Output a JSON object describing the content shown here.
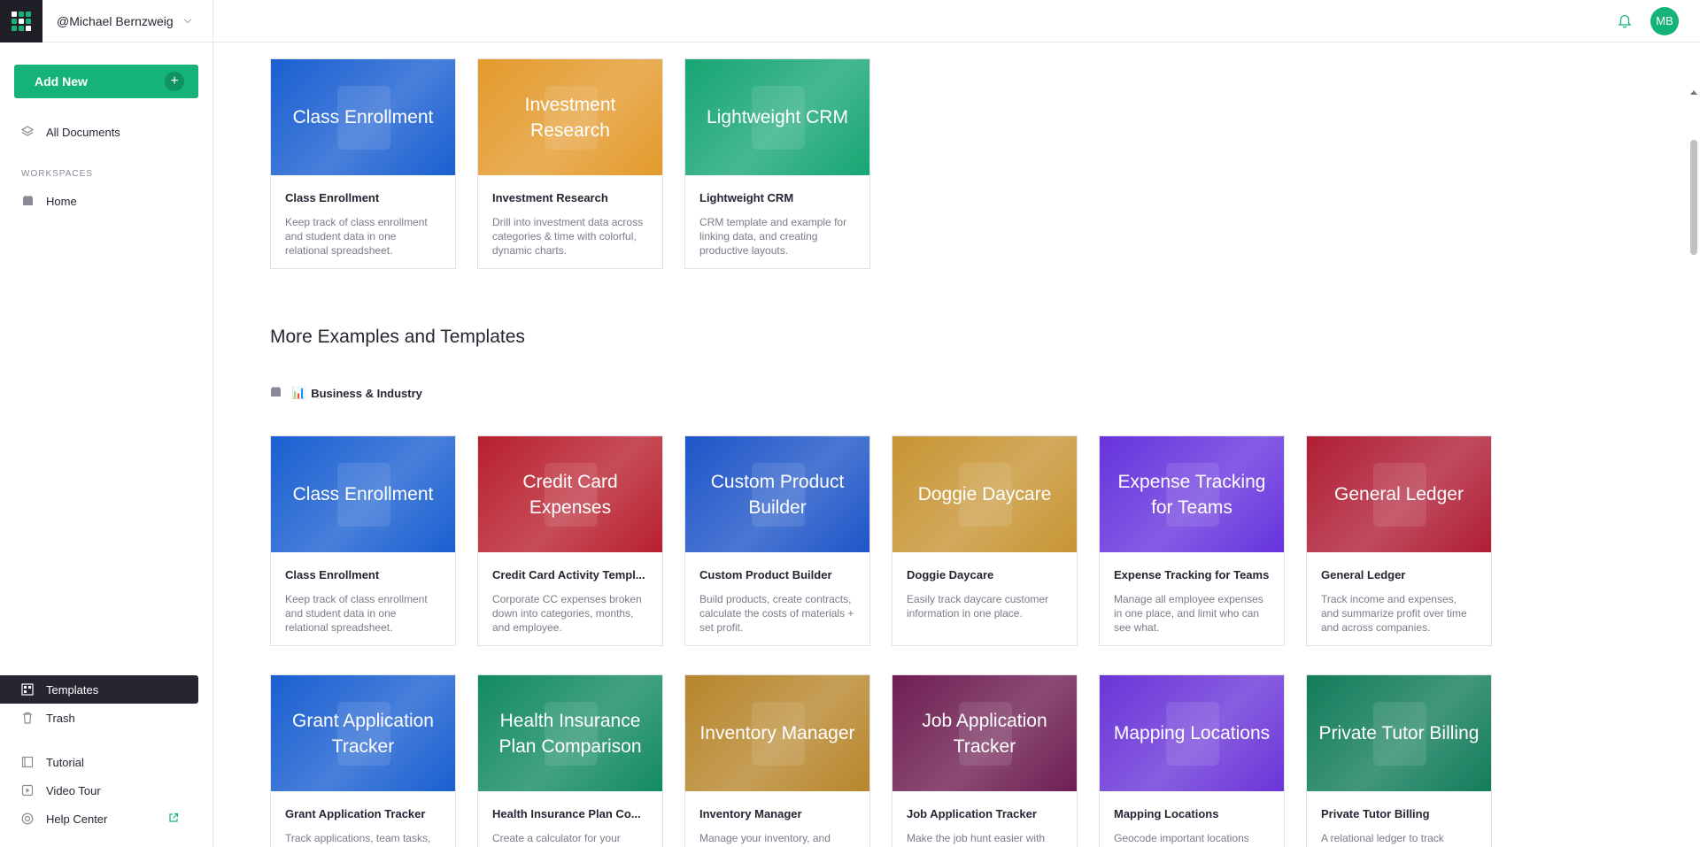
{
  "app": {
    "user_label": "@Michael Bernzweig",
    "avatar_initials": "MB",
    "accent_color": "#16b378"
  },
  "sidebar": {
    "add_new_label": "Add New",
    "all_documents": "All Documents",
    "workspaces_label": "WORKSPACES",
    "home": "Home",
    "templates": "Templates",
    "trash": "Trash",
    "tutorial": "Tutorial",
    "video_tour": "Video Tour",
    "help_center": "Help Center"
  },
  "main": {
    "more_heading": "More Examples and Templates",
    "category_label": "Business & Industry",
    "category_emoji": "📊",
    "featured": [
      {
        "thumb_title": "Class Enrollment",
        "name": "Class Enrollment",
        "desc": "Keep track of class enrollment and student data in one relational spreadsheet.",
        "color": "#1a5fd1"
      },
      {
        "thumb_title": "Investment Research",
        "name": "Investment Research",
        "desc": "Drill into investment data across categories & time with colorful, dynamic charts.",
        "color": "#e39a2c"
      },
      {
        "thumb_title": "Lightweight CRM",
        "name": "Lightweight CRM",
        "desc": "CRM template and example for linking data, and creating productive layouts.",
        "color": "#17a673"
      }
    ],
    "row1": [
      {
        "thumb_title": "Class Enrollment",
        "name": "Class Enrollment",
        "desc": "Keep track of class enrollment and student data in one relational spreadsheet.",
        "color": "#1a5fd1"
      },
      {
        "thumb_title": "Credit Card Expenses",
        "name": "Credit Card Activity Templ...",
        "desc": "Corporate CC expenses broken down into categories, months, and employee.",
        "color": "#b8202e"
      },
      {
        "thumb_title": "Custom Product Builder",
        "name": "Custom Product Builder",
        "desc": "Build products, create contracts, calculate the costs of materials + set profit.",
        "color": "#1e55c8"
      },
      {
        "thumb_title": "Doggie Daycare",
        "name": "Doggie Daycare",
        "desc": "Easily track daycare customer information in one place.",
        "color": "#c79433"
      },
      {
        "thumb_title": "Expense Tracking for Teams",
        "name": "Expense Tracking for Teams",
        "desc": "Manage all employee expenses in one place, and limit who can see what.",
        "color": "#6633dd"
      },
      {
        "thumb_title": "General Ledger",
        "name": "General Ledger",
        "desc": "Track income and expenses, and summarize profit over time and across companies.",
        "color": "#b01e35"
      }
    ],
    "row2": [
      {
        "thumb_title": "Grant Application Tracker",
        "name": "Grant Application Tracker",
        "desc": "Track applications, team tasks,",
        "color": "#1a5fd1"
      },
      {
        "thumb_title": "Health Insurance Plan Comparison",
        "name": "Health Insurance Plan Co...",
        "desc": "Create a calculator for your",
        "color": "#138a63"
      },
      {
        "thumb_title": "Inventory Manager",
        "name": "Inventory Manager",
        "desc": "Manage your inventory, and",
        "color": "#b7862c"
      },
      {
        "thumb_title": "Job Application Tracker",
        "name": "Job Application Tracker",
        "desc": "Make the job hunt easier with",
        "color": "#6e1e52"
      },
      {
        "thumb_title": "Mapping Locations",
        "name": "Mapping Locations",
        "desc": "Geocode important locations",
        "color": "#6a35d8"
      },
      {
        "thumb_title": "Private Tutor Billing",
        "name": "Private Tutor Billing",
        "desc": "A relational ledger to track",
        "color": "#127c5b"
      }
    ]
  }
}
